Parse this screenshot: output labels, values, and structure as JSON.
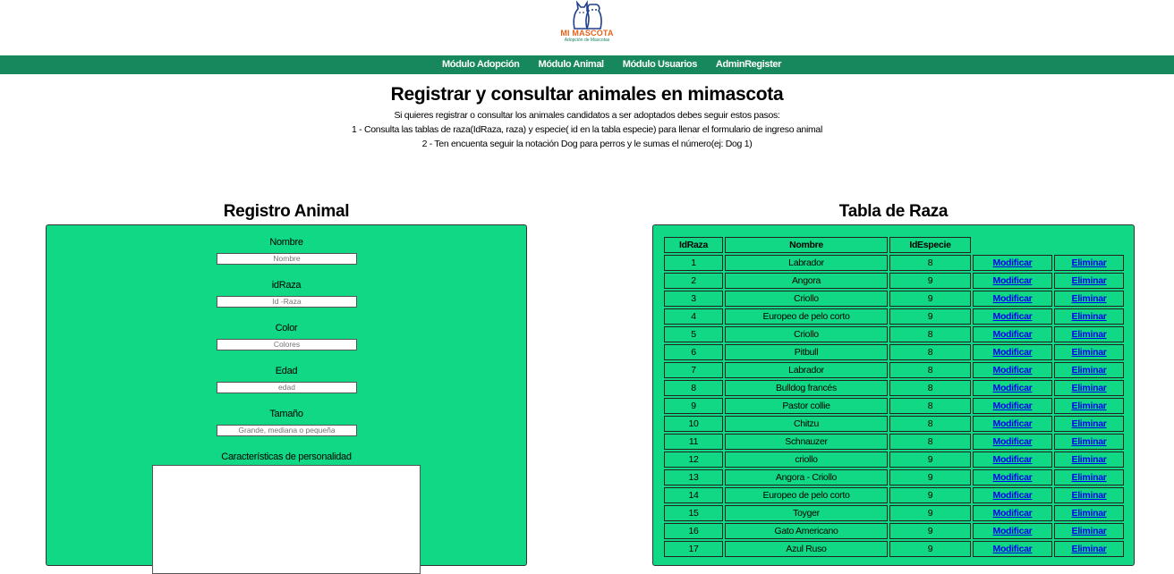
{
  "brand": {
    "name": "MI MASCOTA",
    "tagline": "Adopción de Mascotas",
    "colors": {
      "orange": "#e9641c",
      "green": "#15845a",
      "blue": "#1f3f8f"
    }
  },
  "nav": {
    "items": [
      "Módulo Adopción",
      "Módulo Animal",
      "Módulo Usuarios",
      "AdminRegister"
    ],
    "background": "#17885d"
  },
  "header": {
    "title": "Registrar y consultar animales en mimascota",
    "lines": [
      "Si quieres registrar o consultar los animales candidatos a ser adoptados debes seguir estos pasos:",
      "1 - Consulta las tablas de raza(IdRaza, raza) y especie( id en la tabla especie) para llenar el formulario de ingreso animal",
      "2 - Ten encuenta seguir la notación Dog para perros y le sumas el número(ej: Dog 1)"
    ]
  },
  "register": {
    "title": "Registro Animal",
    "panel_color": "#10d885",
    "fields": [
      {
        "label": "Nombre",
        "placeholder": "Nombre"
      },
      {
        "label": "idRaza",
        "placeholder": "Id -Raza"
      },
      {
        "label": "Color",
        "placeholder": "Colores"
      },
      {
        "label": "Edad",
        "placeholder": "edad"
      },
      {
        "label": "Tamaño",
        "placeholder": "Grande, mediana o pequeña"
      }
    ],
    "personality_label": "Características de personalidad"
  },
  "raza_table": {
    "title": "Tabla de Raza",
    "columns": [
      "IdRaza",
      "Nombre",
      "IdEspecie"
    ],
    "modify_label": "Modificar",
    "delete_label": "Eliminar",
    "rows": [
      [
        "1",
        "Labrador",
        "8"
      ],
      [
        "2",
        "Angora",
        "9"
      ],
      [
        "3",
        "Criollo",
        "9"
      ],
      [
        "4",
        "Europeo de pelo corto",
        "9"
      ],
      [
        "5",
        "Criollo",
        "8"
      ],
      [
        "6",
        "Pitbull",
        "8"
      ],
      [
        "7",
        "Labrador",
        "8"
      ],
      [
        "8",
        "Bulldog francés",
        "8"
      ],
      [
        "9",
        "Pastor collie",
        "8"
      ],
      [
        "10",
        "Chitzu",
        "8"
      ],
      [
        "11",
        "Schnauzer",
        "8"
      ],
      [
        "12",
        "criollo",
        "9"
      ],
      [
        "13",
        "Angora - Criollo",
        "9"
      ],
      [
        "14",
        "Europeo de pelo corto",
        "9"
      ],
      [
        "15",
        "Toyger",
        "9"
      ],
      [
        "16",
        "Gato Americano",
        "9"
      ],
      [
        "17",
        "Azul Ruso",
        "9"
      ]
    ]
  }
}
